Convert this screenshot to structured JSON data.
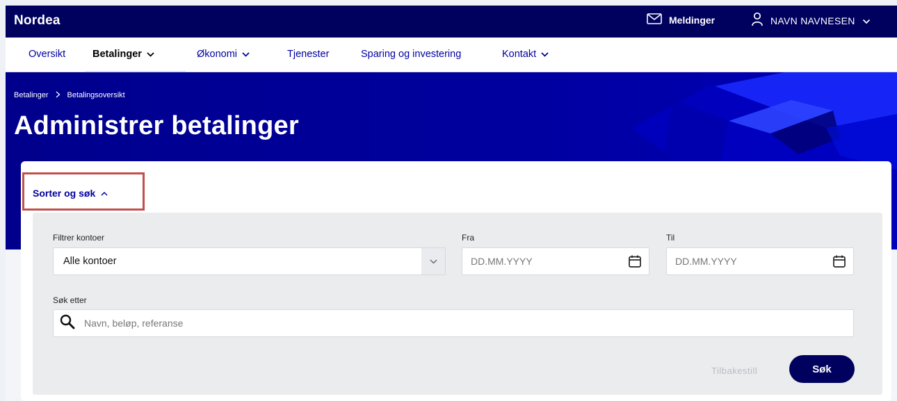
{
  "header": {
    "logo": "Nordea",
    "messages_label": "Meldinger",
    "user_name": "NAVN NAVNESEN"
  },
  "nav": {
    "items": [
      {
        "label": "Oversikt",
        "has_dropdown": false,
        "active": false
      },
      {
        "label": "Betalinger",
        "has_dropdown": true,
        "active": true
      },
      {
        "label": "Økonomi",
        "has_dropdown": true,
        "active": false
      },
      {
        "label": "Tjenester",
        "has_dropdown": false,
        "active": false
      },
      {
        "label": "Sparing og investering",
        "has_dropdown": false,
        "active": false
      },
      {
        "label": "Kontakt",
        "has_dropdown": true,
        "active": false
      }
    ]
  },
  "breadcrumb": {
    "items": [
      "Betalinger",
      "Betalingsoversikt"
    ]
  },
  "page": {
    "title": "Administrer betalinger"
  },
  "filters": {
    "toggle_label": "Sorter og søk",
    "accounts_label": "Filtrer kontoer",
    "accounts_value": "Alle kontoer",
    "from_label": "Fra",
    "from_placeholder": "DD.MM.YYYY",
    "to_label": "Til",
    "to_placeholder": "DD.MM.YYYY",
    "search_label": "Søk etter",
    "search_placeholder": "Navn, beløp, referanse",
    "reset_label": "Tilbakestill",
    "search_button": "Søk"
  },
  "colors": {
    "brand_dark": "#00005e",
    "hero_blue": "#00009e",
    "link_blue": "#0000a0",
    "highlight": "#c0504d"
  }
}
